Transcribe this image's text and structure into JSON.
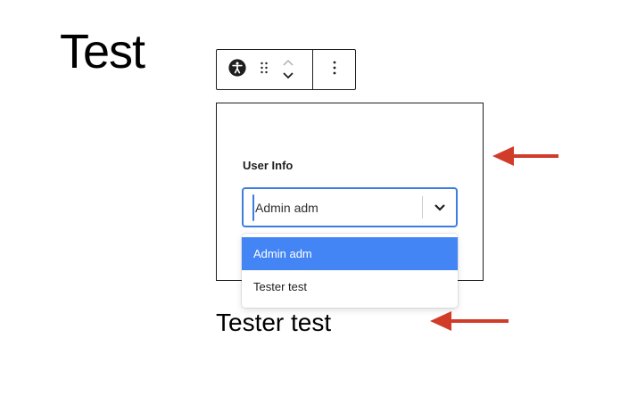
{
  "page": {
    "title": "Test"
  },
  "toolbar": {
    "items": [
      {
        "name": "block-type",
        "icon": "accessibility-icon"
      },
      {
        "name": "drag-handle",
        "icon": "drag-handle-icon"
      },
      {
        "name": "move-up",
        "icon": "chevron-up-icon"
      },
      {
        "name": "move-down",
        "icon": "chevron-down-icon"
      },
      {
        "name": "options",
        "icon": "vertical-ellipsis-icon"
      }
    ]
  },
  "block": {
    "field_label": "User Info",
    "select": {
      "value": "Admin adm",
      "indicator_icon": "chevron-down-icon",
      "focus_color": "#3d7de0"
    },
    "options": [
      {
        "label": "Admin adm",
        "selected": true
      },
      {
        "label": "Tester test",
        "selected": false
      }
    ],
    "option_highlight_color": "#4385f5"
  },
  "output": {
    "text": "Tester test"
  },
  "annotations": {
    "arrow_color": "#d13b2a"
  }
}
